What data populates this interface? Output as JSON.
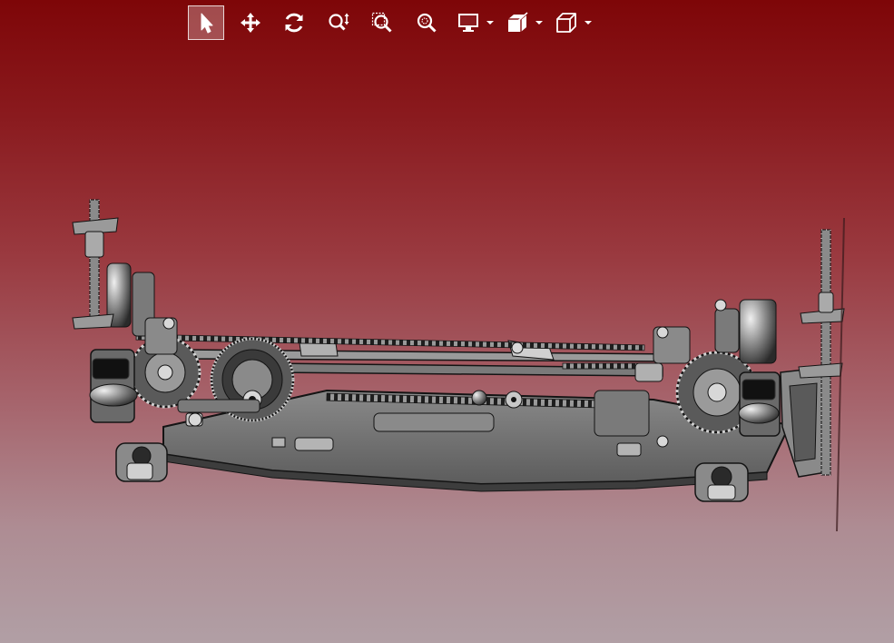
{
  "viewer": {
    "colors": {
      "background_top": "#7e0608",
      "background_bottom": "#b19fa5",
      "model_fill": "#6b6b6b",
      "model_line": "#141414",
      "highlight": "#d8d8d8"
    }
  },
  "toolbar": {
    "tools": [
      {
        "id": "select",
        "icon": "arrow-cursor-icon",
        "active": true
      },
      {
        "id": "pan",
        "icon": "move-arrows-icon",
        "active": false
      },
      {
        "id": "rotate",
        "icon": "rotate-icon",
        "active": false
      },
      {
        "id": "zoom",
        "icon": "zoom-updown-icon",
        "active": false
      },
      {
        "id": "zoom-window",
        "icon": "zoom-window-icon",
        "active": false
      },
      {
        "id": "zoom-fit",
        "icon": "zoom-fit-icon",
        "active": false
      },
      {
        "id": "display-mode",
        "icon": "monitor-icon",
        "active": false,
        "dropdown": true
      },
      {
        "id": "section",
        "icon": "section-plane-icon",
        "active": false,
        "dropdown": true
      },
      {
        "id": "standard-views",
        "icon": "view-cube-icon",
        "active": false,
        "dropdown": true
      }
    ]
  },
  "model": {
    "subject": "rc-car-chassis-assembly",
    "render_style": "shaded-with-edges"
  }
}
